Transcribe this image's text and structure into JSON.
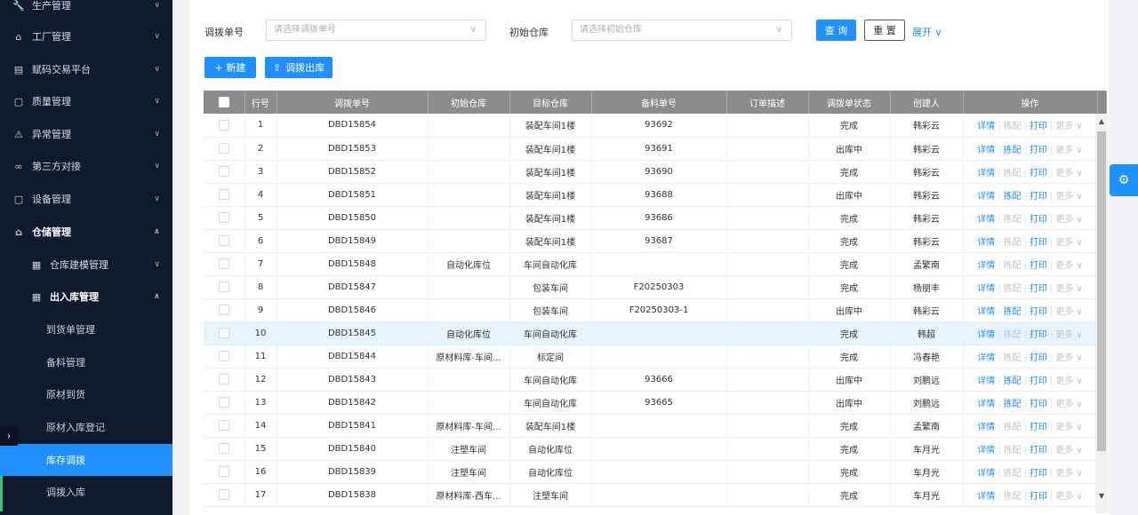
{
  "sidebar": {
    "items": [
      {
        "label": "生产管理",
        "icon": "wrench-icon"
      },
      {
        "label": "工厂管理",
        "icon": "home-icon"
      },
      {
        "label": "赋码交易平台",
        "icon": "grid-icon"
      },
      {
        "label": "质量管理",
        "icon": "document-icon"
      },
      {
        "label": "异常管理",
        "icon": "alert-icon"
      },
      {
        "label": "第三方对接",
        "icon": "link-icon"
      },
      {
        "label": "设备管理",
        "icon": "device-icon"
      },
      {
        "label": "仓储管理",
        "icon": "home-icon"
      }
    ],
    "sub1": [
      {
        "label": "仓库建模管理"
      },
      {
        "label": "出入库管理"
      }
    ],
    "sub2": [
      {
        "label": "到货单管理"
      },
      {
        "label": "备料管理"
      },
      {
        "label": "原材到货"
      },
      {
        "label": "原材入库登记"
      },
      {
        "label": "库存调拨"
      },
      {
        "label": "调拨入库"
      }
    ]
  },
  "filters": {
    "transfer_no_label": "调拨单号",
    "transfer_no_placeholder": "请选择调拨单号",
    "warehouse_label": "初始仓库",
    "warehouse_placeholder": "请选择初始仓库",
    "query_label": "查 询",
    "reset_label": "重 置",
    "expand_label": "展开 ∨"
  },
  "actions": {
    "new_label": "+ 新建",
    "transfer_out_label": "调拨出库"
  },
  "table": {
    "columns": [
      "行号",
      "调拨单号",
      "初始仓库",
      "目标仓库",
      "备料单号",
      "订单描述",
      "调拨单状态",
      "创建人",
      "操作"
    ],
    "rows": [
      {
        "no": "1",
        "id": "DBD15854",
        "src": "",
        "dst": "装配车间1楼",
        "prep": "93692",
        "desc": "",
        "status": "完成",
        "creator": "韩彩云"
      },
      {
        "no": "2",
        "id": "DBD15853",
        "src": "",
        "dst": "装配车间1楼",
        "prep": "93691",
        "desc": "",
        "status": "出库中",
        "creator": "韩彩云"
      },
      {
        "no": "3",
        "id": "DBD15852",
        "src": "",
        "dst": "装配车间1楼",
        "prep": "93690",
        "desc": "",
        "status": "完成",
        "creator": "韩彩云"
      },
      {
        "no": "4",
        "id": "DBD15851",
        "src": "",
        "dst": "装配车间1楼",
        "prep": "93688",
        "desc": "",
        "status": "出库中",
        "creator": "韩彩云"
      },
      {
        "no": "5",
        "id": "DBD15850",
        "src": "",
        "dst": "装配车间1楼",
        "prep": "93686",
        "desc": "",
        "status": "完成",
        "creator": "韩彩云"
      },
      {
        "no": "6",
        "id": "DBD15849",
        "src": "",
        "dst": "装配车间1楼",
        "prep": "93687",
        "desc": "",
        "status": "完成",
        "creator": "韩彩云"
      },
      {
        "no": "7",
        "id": "DBD15848",
        "src": "自动化库位",
        "dst": "车间自动化库",
        "prep": "",
        "desc": "",
        "status": "完成",
        "creator": "孟繁南"
      },
      {
        "no": "8",
        "id": "DBD15847",
        "src": "",
        "dst": "包装车间",
        "prep": "F20250303",
        "desc": "",
        "status": "完成",
        "creator": "杨朋丰"
      },
      {
        "no": "9",
        "id": "DBD15846",
        "src": "",
        "dst": "包装车间",
        "prep": "F20250303-1",
        "desc": "",
        "status": "出库中",
        "creator": "韩彩云"
      },
      {
        "no": "10",
        "id": "DBD15845",
        "src": "自动化库位",
        "dst": "车间自动化库",
        "prep": "",
        "desc": "",
        "status": "完成",
        "creator": "韩超"
      },
      {
        "no": "11",
        "id": "DBD15844",
        "src": "原材料库-车间...",
        "dst": "标定间",
        "prep": "",
        "desc": "",
        "status": "完成",
        "creator": "冯春艳"
      },
      {
        "no": "12",
        "id": "DBD15843",
        "src": "",
        "dst": "车间自动化库",
        "prep": "93666",
        "desc": "",
        "status": "出库中",
        "creator": "刘鹏远"
      },
      {
        "no": "13",
        "id": "DBD15842",
        "src": "",
        "dst": "车间自动化库",
        "prep": "93665",
        "desc": "",
        "status": "出库中",
        "creator": "刘鹏远"
      },
      {
        "no": "14",
        "id": "DBD15841",
        "src": "原材料库-车间...",
        "dst": "装配车间1楼",
        "prep": "",
        "desc": "",
        "status": "完成",
        "creator": "孟繁南"
      },
      {
        "no": "15",
        "id": "DBD15840",
        "src": "注塑车间",
        "dst": "自动化库位",
        "prep": "",
        "desc": "",
        "status": "完成",
        "creator": "车月光"
      },
      {
        "no": "16",
        "id": "DBD15839",
        "src": "注塑车间",
        "dst": "自动化库位",
        "prep": "",
        "desc": "",
        "status": "完成",
        "creator": "车月光"
      },
      {
        "no": "17",
        "id": "DBD15838",
        "src": "原材料库-西车...",
        "dst": "注塑车间",
        "prep": "",
        "desc": "",
        "status": "完成",
        "creator": "车月光"
      }
    ],
    "ops": {
      "detail": "详情",
      "match": "拣配",
      "print": "打印",
      "more": "更多 ∨"
    }
  }
}
